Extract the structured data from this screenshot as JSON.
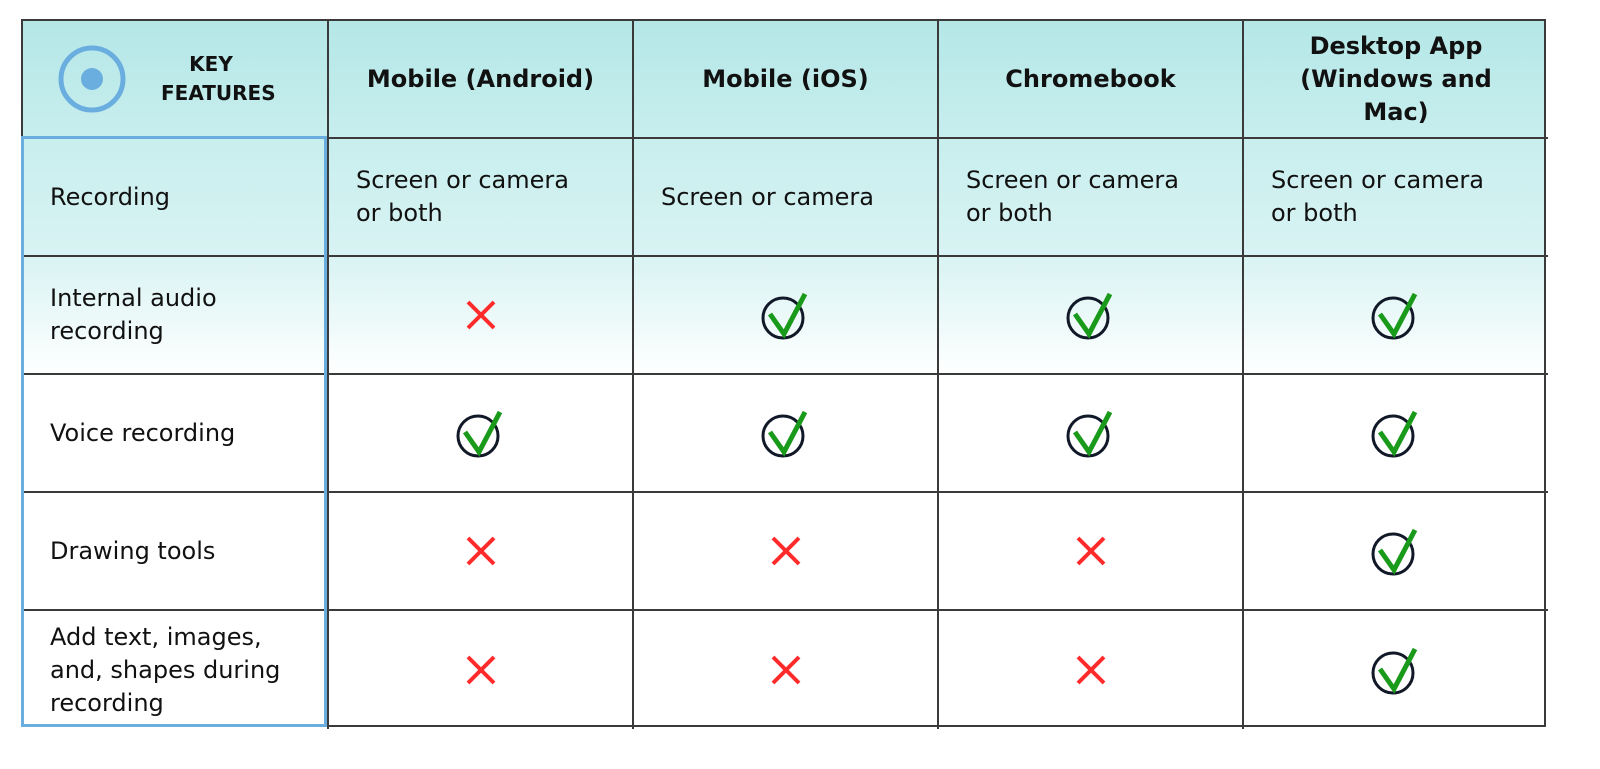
{
  "table": {
    "header": {
      "feature_label": "KEY FEATURES",
      "feature_icon": "record-icon",
      "columns": [
        "Mobile (Android)",
        "Mobile (iOS)",
        "Chromebook",
        "Desktop App (Windows and Mac)"
      ]
    },
    "rows": [
      {
        "feature": "Recording",
        "values": [
          "Screen or camera or both",
          "Screen or camera",
          "Screen or camera or both",
          "Screen or camera or both"
        ]
      },
      {
        "feature": "Internal audio recording",
        "values": [
          "no",
          "yes",
          "yes",
          "yes"
        ]
      },
      {
        "feature": "Voice recording",
        "values": [
          "yes",
          "yes",
          "yes",
          "yes"
        ]
      },
      {
        "feature": "Drawing tools",
        "values": [
          "no",
          "no",
          "no",
          "yes"
        ]
      },
      {
        "feature": "Add text, images, and, shapes during recording",
        "values": [
          "no",
          "no",
          "no",
          "yes"
        ]
      }
    ]
  },
  "colors": {
    "header_bg": "#b5e7e7",
    "accent_blue": "#6aaee0",
    "check_green": "#1a9a1a",
    "cross_red": "#ff2a2a",
    "border": "#3a3a3a"
  }
}
